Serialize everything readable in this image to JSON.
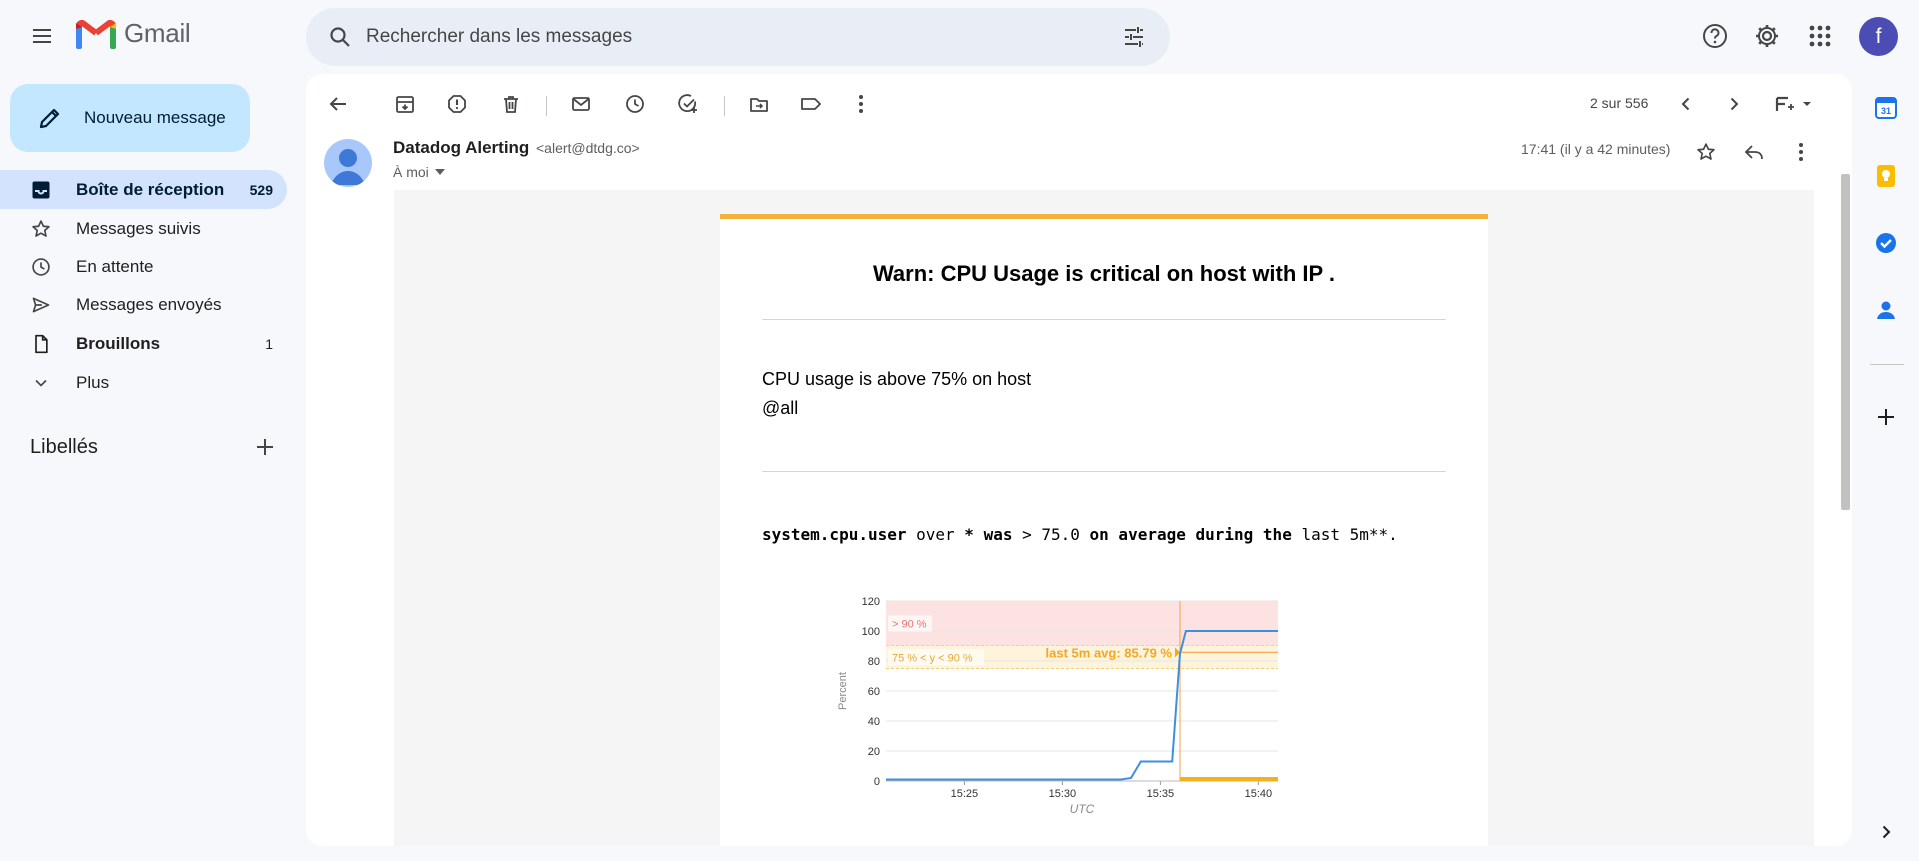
{
  "app": {
    "name": "Gmail"
  },
  "search": {
    "placeholder": "Rechercher dans les messages"
  },
  "compose": {
    "label": "Nouveau message"
  },
  "nav": {
    "items": [
      {
        "label": "Boîte de réception",
        "count": "529",
        "icon": "inbox-icon",
        "active": true
      },
      {
        "label": "Messages suivis",
        "count": "",
        "icon": "star-icon"
      },
      {
        "label": "En attente",
        "count": "",
        "icon": "clock-icon"
      },
      {
        "label": "Messages envoyés",
        "count": "",
        "icon": "send-icon"
      },
      {
        "label": "Brouillons",
        "count": "1",
        "icon": "draft-icon"
      },
      {
        "label": "Plus",
        "count": "",
        "icon": "chevron-down-icon"
      }
    ],
    "labels_title": "Libellés"
  },
  "toolbar": {
    "pager": "2 sur 556"
  },
  "message": {
    "sender_name": "Datadog Alerting",
    "sender_email": "<alert@dtdg.co>",
    "to": "À moi",
    "timestamp": "17:41 (il y a 42 minutes)",
    "title": "Warn: CPU Usage is critical on host with IP .",
    "body_line1": "CPU usage is above 75% on host",
    "body_line2": "@all",
    "query": {
      "metric": "system.cpu.user",
      "over": " over ",
      "star_was": "* was",
      "gt": " > 75.0 ",
      "on_avg": "on average during the",
      "last": " last 5m",
      "tail": "**."
    }
  },
  "chart_data": {
    "type": "line",
    "ylabel": "Percent",
    "xlabel": "UTC",
    "ylim": [
      0,
      120
    ],
    "yticks": [
      0,
      20,
      40,
      60,
      80,
      100,
      120
    ],
    "xticks": [
      "15:25",
      "15:30",
      "15:35",
      "15:40"
    ],
    "x_minutes_range": [
      15.21,
      15.41
    ],
    "thresholds": [
      {
        "label": "> 90 %",
        "from": 90,
        "to": 120,
        "color": "#fde2e2"
      },
      {
        "label": "75 % < y < 90 %",
        "from": 75,
        "to": 90,
        "color": "#fef4dc"
      }
    ],
    "annotation": "last 5m avg: 85.79 %",
    "annotation_value": 85.79,
    "series": [
      {
        "color": "#3d8fe0",
        "points": [
          [
            "15:21",
            1
          ],
          [
            "15:23",
            1
          ],
          [
            "15:25",
            1
          ],
          [
            "15:27",
            1
          ],
          [
            "15:29",
            1
          ],
          [
            "15:31",
            1
          ],
          [
            "15:33",
            1
          ],
          [
            "15:33.5",
            2
          ],
          [
            "15:34",
            13
          ],
          [
            "15:35",
            13
          ],
          [
            "15:35.6",
            13
          ],
          [
            "15:36",
            85
          ],
          [
            "15:36.3",
            100
          ],
          [
            "15:38",
            100
          ],
          [
            "15:41",
            100
          ]
        ]
      }
    ]
  },
  "colors": {
    "accent": "#c2e7ff",
    "active_nav": "#d3e3fd",
    "alert_warn": "#f2b33d",
    "series": "#3d8fe0"
  }
}
